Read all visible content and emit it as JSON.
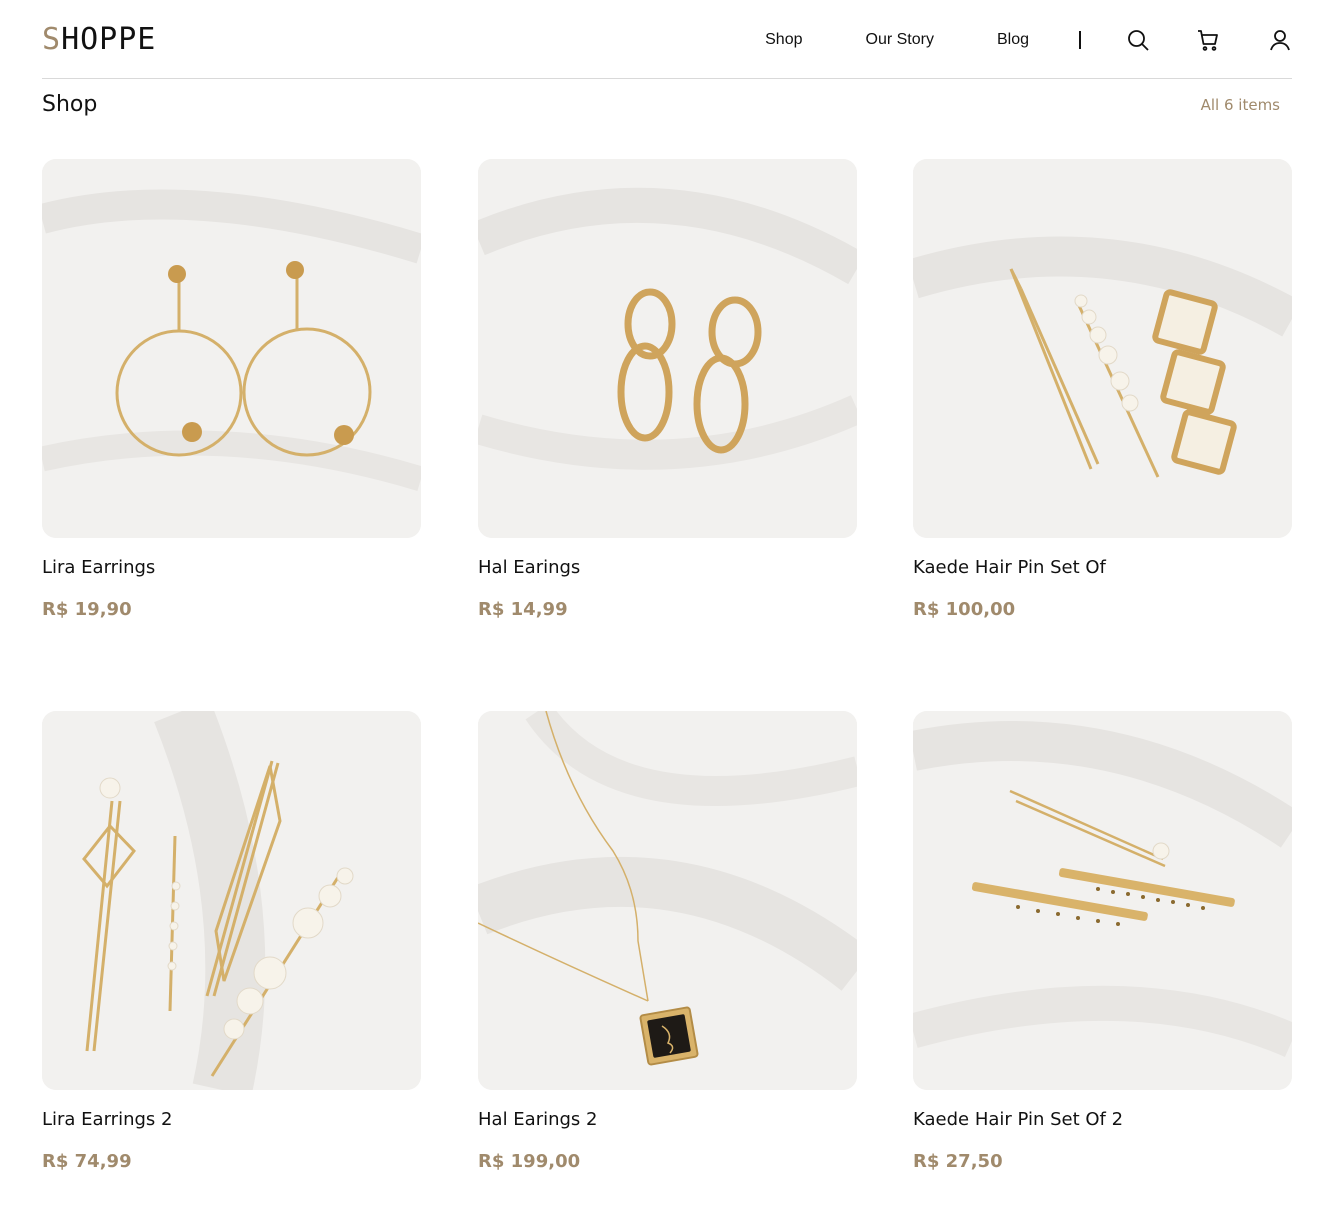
{
  "header": {
    "logo_first": "S",
    "logo_rest": "HOPPE",
    "nav": [
      "Shop",
      "Our Story",
      "Blog"
    ],
    "icons": [
      "search-icon",
      "cart-icon",
      "user-icon"
    ]
  },
  "page": {
    "title": "Shop",
    "count": "All 6 items"
  },
  "colors": {
    "accent": "#a08a6c",
    "gold": "#d4b06a",
    "background": "#f2f1ef"
  },
  "products": [
    {
      "name": "Lira Earrings",
      "price": "R$ 19,90"
    },
    {
      "name": "Hal Earings",
      "price": "R$ 14,99"
    },
    {
      "name": "Kaede Hair Pin Set Of",
      "price": "R$ 100,00"
    },
    {
      "name": "Lira Earrings 2",
      "price": "R$ 74,99"
    },
    {
      "name": "Hal Earings 2",
      "price": "R$ 199,00"
    },
    {
      "name": "Kaede Hair Pin Set Of 2",
      "price": "R$ 27,50"
    }
  ]
}
